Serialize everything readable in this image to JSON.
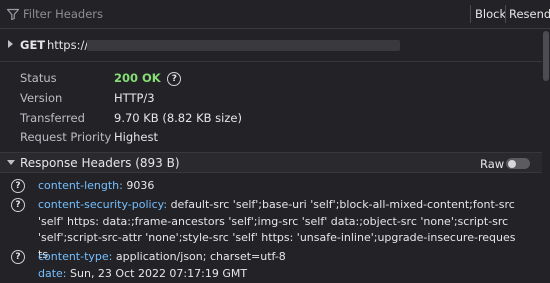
{
  "toolbar": {
    "filter_placeholder": "Filter Headers",
    "block_label": "Block",
    "resend_label": "Resend"
  },
  "request": {
    "method": "GET",
    "url_prefix": "https://"
  },
  "summary": [
    {
      "key": "Status",
      "value": "200 OK"
    },
    {
      "key": "Version",
      "value": "HTTP/3"
    },
    {
      "key": "Transferred",
      "value": "9.70 KB (8.82 KB size)"
    },
    {
      "key": "Request Priority",
      "value": "Highest"
    }
  ],
  "response_headers": {
    "title": "Response Headers (893 B)",
    "raw_label": "Raw",
    "raw_enabled": false,
    "items": [
      {
        "name": "content-length:",
        "value": "9036"
      },
      {
        "name": "content-security-policy:",
        "value": "default-src 'self';base-uri 'self';block-all-mixed-content;font-src 'self' https: data:;frame-ancestors 'self';img-src 'self' data:;object-src 'none';script-src 'self';script-src-attr 'none';style-src 'self' https: 'unsafe-inline';upgrade-insecure-requests"
      },
      {
        "name": "content-type:",
        "value": "application/json; charset=utf-8"
      },
      {
        "name": "date:",
        "value": "Sun, 23 Oct 2022 07:17:19 GMT"
      }
    ]
  },
  "colors": {
    "background": "#232327",
    "status_ok": "#86de74",
    "header_name": "#75bfff"
  }
}
